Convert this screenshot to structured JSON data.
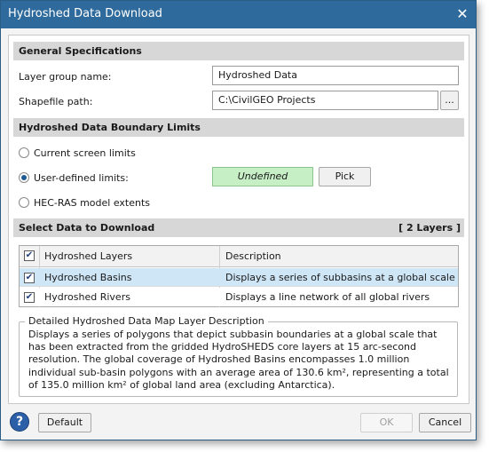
{
  "window": {
    "title": "Hydroshed Data Download"
  },
  "general": {
    "heading": "General Specifications",
    "layer_group_label": "Layer group name:",
    "layer_group_value": "Hydroshed Data",
    "shapefile_label": "Shapefile path:",
    "shapefile_value": "C:\\CivilGEO Projects",
    "browse_label": "..."
  },
  "boundary": {
    "heading": "Hydroshed Data Boundary Limits",
    "options": [
      "Current screen limits",
      "User-defined limits:",
      "HEC-RAS model extents"
    ],
    "selected_option": "User-defined limits:",
    "status_value": "Undefined",
    "pick_label": "Pick"
  },
  "select": {
    "heading": "Select Data to Download",
    "count": "[ 2 Layers ]",
    "columns": [
      "Hydroshed Layers",
      "Description"
    ],
    "rows": [
      {
        "name": "Hydroshed Basins",
        "description": "Displays a series of subbasins at a global scale",
        "checked": true,
        "selected": true
      },
      {
        "name": "Hydroshed Rivers",
        "description": "Displays a line network of all global rivers",
        "checked": true,
        "selected": false
      }
    ]
  },
  "details": {
    "legend": "Detailed Hydroshed Data Map Layer Description",
    "text": "Displays a series of polygons that depict subbasin boundaries at a global scale that has been extracted from the gridded HydroSHEDS core layers at 15 arc-second resolution. The global coverage of Hydroshed Basins encompasses 1.0 million individual sub-basin polygons with an average area of 130.6 km², representing a total of 135.0 million km² of global land area (excluding Antarctica)."
  },
  "footer": {
    "help_icon_text": "?",
    "default_label": "Default",
    "ok_label": "OK",
    "cancel_label": "Cancel"
  },
  "colors": {
    "titlebar": "#2e6a9c",
    "section": "#d7d7d7",
    "status_fill": "#c6efc6",
    "selected_row": "#cfe6f7"
  },
  "icons": {
    "close": "close-icon",
    "help": "help-icon",
    "check": "check-icon"
  }
}
